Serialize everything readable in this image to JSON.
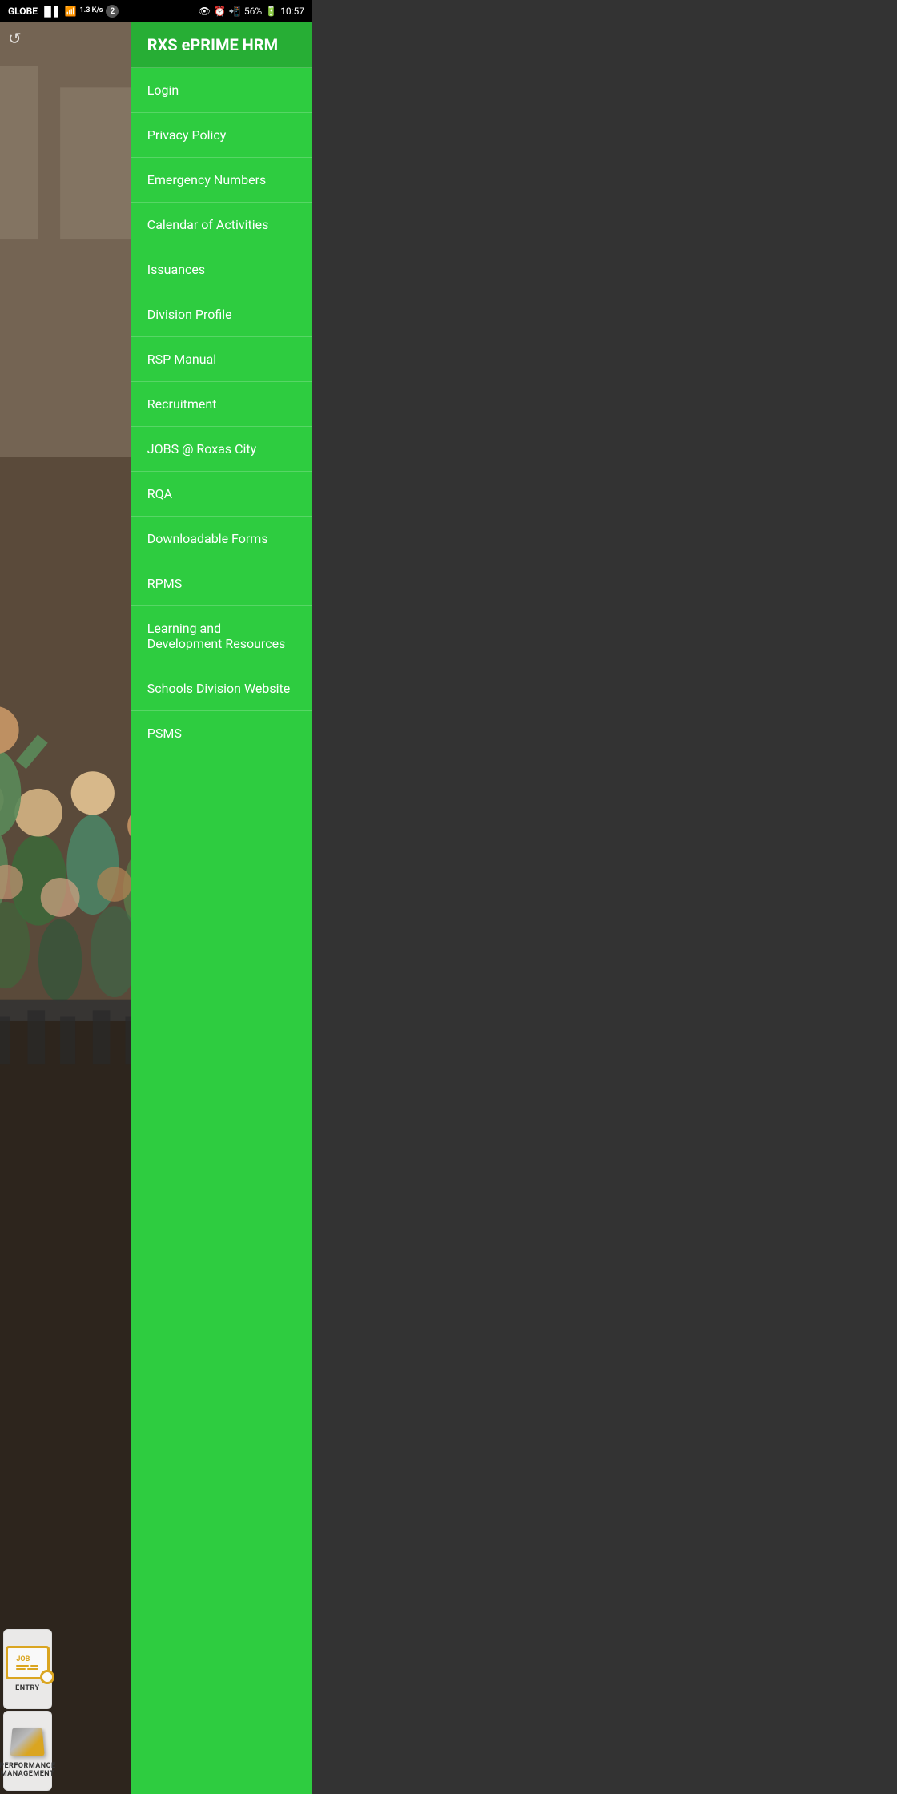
{
  "status_bar": {
    "carrier": "GLOBE",
    "speed": "1.3 K/s",
    "notification_count": "2",
    "battery": "56%",
    "time": "10:57"
  },
  "drawer": {
    "title": "RXS ePRIME HRM",
    "items": [
      {
        "id": "login",
        "label": "Login"
      },
      {
        "id": "privacy-policy",
        "label": "Privacy Policy"
      },
      {
        "id": "emergency-numbers",
        "label": "Emergency Numbers"
      },
      {
        "id": "calendar-of-activities",
        "label": "Calendar of Activities"
      },
      {
        "id": "issuances",
        "label": "Issuances"
      },
      {
        "id": "division-profile",
        "label": "Division Profile"
      },
      {
        "id": "rsp-manual",
        "label": "RSP Manual"
      },
      {
        "id": "recruitment",
        "label": "Recruitment"
      },
      {
        "id": "jobs-roxas-city",
        "label": "JOBS @ Roxas City"
      },
      {
        "id": "rqa",
        "label": "RQA"
      },
      {
        "id": "downloadable-forms",
        "label": "Downloadable Forms"
      },
      {
        "id": "rpms",
        "label": "RPMS"
      },
      {
        "id": "learning-development",
        "label": "Learning and Development Resources"
      },
      {
        "id": "schools-division-website",
        "label": "Schools Division Website"
      },
      {
        "id": "psms",
        "label": "PSMS"
      }
    ]
  },
  "cards": [
    {
      "id": "entry",
      "label": "ENTRY",
      "type": "job"
    },
    {
      "id": "performance-management",
      "label": "PERFORMANCE MANAGEMENT",
      "type": "performance"
    }
  ],
  "colors": {
    "drawer_bg": "#2ecc40",
    "drawer_header_bg": "#27ae35",
    "drawer_text": "#ffffff",
    "status_bar_bg": "#000000"
  }
}
